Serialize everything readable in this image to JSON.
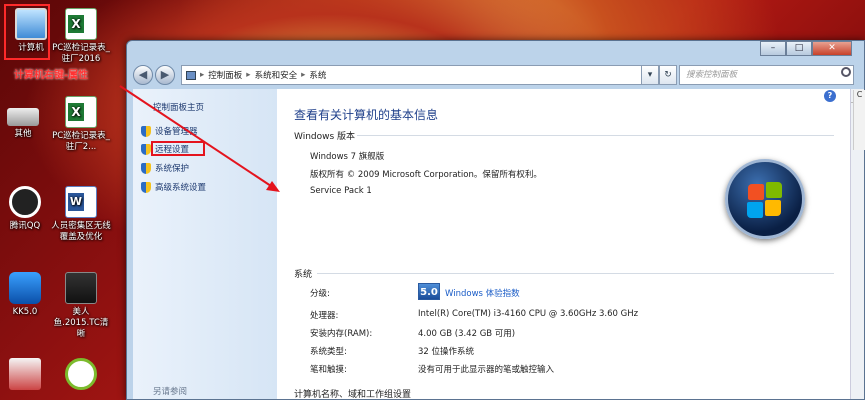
{
  "desktop": {
    "icons": [
      {
        "label": "计算机"
      },
      {
        "label": "PC巡检记录表_驻厂2016"
      },
      {
        "label": "其他"
      },
      {
        "label": "PC巡检记录表_驻厂2..."
      },
      {
        "label": "腾讯QQ"
      },
      {
        "label": "人员密集区无线覆盖及优化"
      },
      {
        "label": "KK5.0"
      },
      {
        "label": "美人鱼.2015.TC清晰"
      }
    ],
    "annotation": "计算机右键-属性"
  },
  "window": {
    "caption_buttons": [
      "–",
      "□",
      "✕"
    ],
    "breadcrumb": [
      "控制面板",
      "系统和安全",
      "系统"
    ],
    "search_placeholder": "搜索控制面板",
    "left_pane": {
      "home": "控制面板主页",
      "items": [
        "设备管理器",
        "远程设置",
        "系统保护",
        "高级系统设置"
      ],
      "see_also": "另请参阅"
    },
    "main": {
      "title": "查看有关计算机的基本信息",
      "edition_heading": "Windows 版本",
      "edition": "Windows 7 旗舰版",
      "copyright": "版权所有 © 2009 Microsoft Corporation。保留所有权利。",
      "service_pack": "Service Pack 1",
      "system_heading": "系统",
      "rating_label": "分级:",
      "rating_score": "5.0",
      "rating_link": "Windows 体验指数",
      "rows": [
        {
          "label": "处理器:",
          "value": "Intel(R) Core(TM) i3-4160 CPU @ 3.60GHz   3.60 GHz"
        },
        {
          "label": "安装内存(RAM):",
          "value": "4.00 GB (3.42 GB 可用)"
        },
        {
          "label": "系统类型:",
          "value": "32 位操作系统"
        },
        {
          "label": "笔和触摸:",
          "value": "没有可用于此显示器的笔或触控输入"
        }
      ],
      "name_heading": "计算机名称、域和工作组设置"
    }
  },
  "colors": {
    "highlight": "#e4141e",
    "link": "#1a5cc7",
    "heading": "#1e3f8a"
  }
}
